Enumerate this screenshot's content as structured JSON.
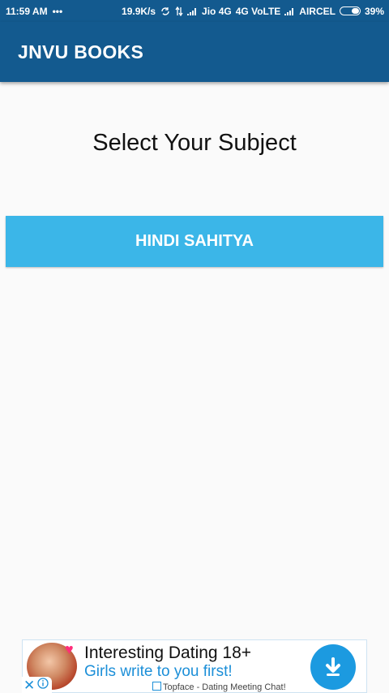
{
  "status_bar": {
    "time": "11:59 AM",
    "more_indicator": "•••",
    "network_speed": "19.9K/s",
    "carrier1": "Jio 4G",
    "network_type": "4G VoLTE",
    "carrier2": "AIRCEL",
    "battery_percent": "39%",
    "battery_level": 0.39
  },
  "app_bar": {
    "title": "JNVU BOOKS",
    "background_color": "#135a8f"
  },
  "main": {
    "heading": "Select Your Subject",
    "subjects": [
      {
        "label": "HINDI SAHITYA",
        "color": "#3bb6e8"
      }
    ]
  },
  "ad": {
    "headline": "Interesting Dating 18+",
    "subline": "Girls write to you first!",
    "source": "Topface - Dating Meeting Chat!",
    "download_icon": "download-icon",
    "close_icon": "close-icon",
    "info_icon": "info-icon"
  }
}
